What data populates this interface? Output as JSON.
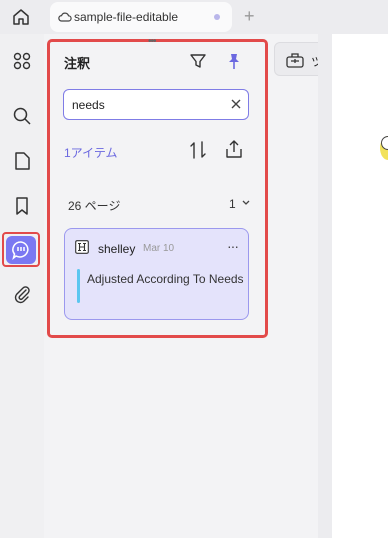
{
  "tab": {
    "title": "sample-file-editable",
    "new_tab": "+"
  },
  "rail": {
    "items": [
      {
        "name": "thumbnails-icon"
      },
      {
        "name": "search-icon"
      },
      {
        "name": "pages-icon"
      },
      {
        "name": "bookmark-icon"
      },
      {
        "name": "comment-icon",
        "active": true
      },
      {
        "name": "attachment-icon"
      }
    ]
  },
  "panel": {
    "title": "注釈",
    "search": {
      "value": "needs"
    },
    "count_label": "1アイテム",
    "group": {
      "page_label": "26 ページ",
      "count": "1"
    },
    "annotations": [
      {
        "author": "shelley",
        "date": "Mar 10",
        "more": "···",
        "text": "Adjusted According To Needs"
      }
    ]
  },
  "toolbar": {
    "tool_label": "ツール"
  },
  "colors": {
    "accent": "#7b78f2",
    "highlight_frame": "#e24a4a",
    "card_bg": "#e4e3fb",
    "card_bar": "#5cc6f0"
  }
}
